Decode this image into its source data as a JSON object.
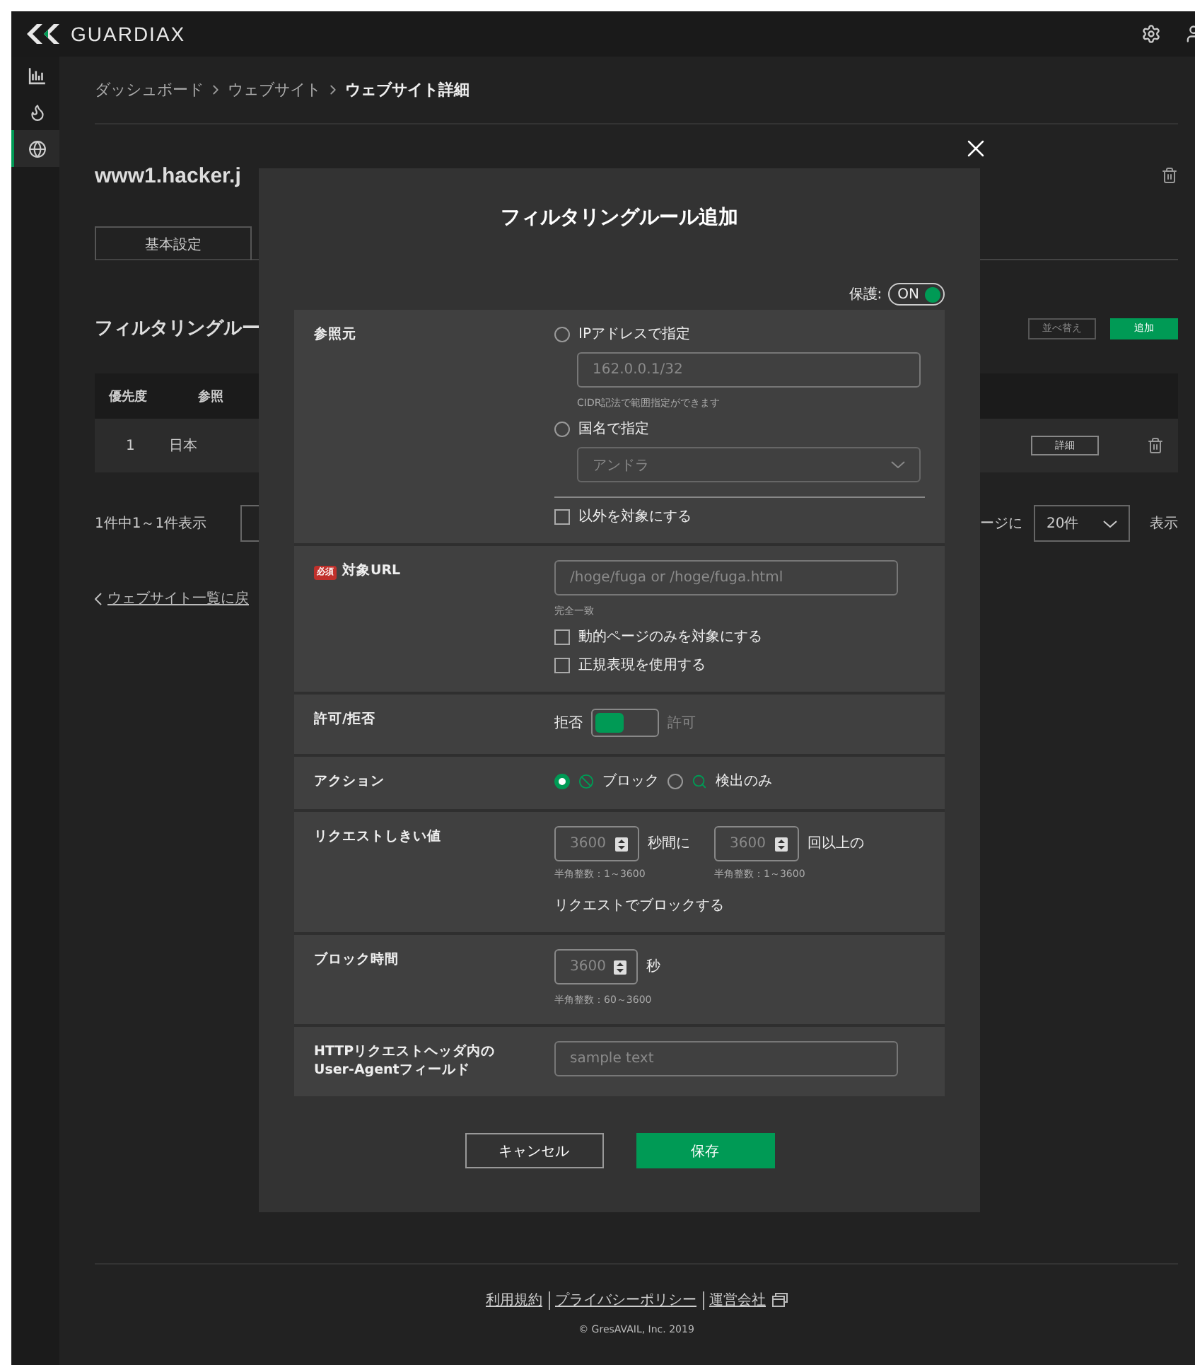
{
  "header": {
    "logo": "GUARDIAX"
  },
  "sidebar": {
    "items": [
      {
        "kind": "chart",
        "selected": false
      },
      {
        "kind": "flame",
        "selected": false
      },
      {
        "kind": "globe",
        "selected": true
      }
    ]
  },
  "breadcrumb": [
    {
      "label": "ダッシュボード",
      "current": false
    },
    {
      "label": "ウェブサイト",
      "current": false
    },
    {
      "label": "ウェブサイト詳細",
      "current": true
    }
  ],
  "site": {
    "title": "www1.hacker.j"
  },
  "tabs": [
    {
      "label": "基本設定",
      "selected": false
    }
  ],
  "section": {
    "title": "フィルタリングルー",
    "buttons": [
      {
        "label": "並べ替え",
        "kind": "outline"
      },
      {
        "label": "追加",
        "kind": "primary"
      }
    ]
  },
  "table": {
    "columns": [
      "優先度",
      "参照"
    ],
    "rows": [
      {
        "cells": [
          "1",
          "日本"
        ],
        "action": "詳細"
      }
    ]
  },
  "pagination": {
    "summary": "1件中1～1件表示",
    "per_page_prefix": "ージに",
    "per_page": "20件",
    "suffix": "表示"
  },
  "back_link": "ウェブサイト一覧に戻",
  "footer": {
    "links": [
      "利用規約",
      "プライバシーポリシー",
      "運営会社"
    ],
    "copyright": "© GresAVAIL, Inc. 2019"
  },
  "modal": {
    "title": "フィルタリングルール追加",
    "protection": {
      "label": "保護:",
      "value": "ON",
      "on": true
    },
    "rows": [
      {
        "kind": "source",
        "label": "参照元",
        "options": [
          {
            "label": "IPアドレスで指定",
            "selected": false
          },
          {
            "label": "国名で指定",
            "selected": false
          }
        ],
        "ip_placeholder": "162.0.0.1/32",
        "ip_hint": "CIDR記法で範囲指定ができます",
        "country": {
          "value": "アンドラ",
          "disabled": true
        },
        "exclude": {
          "label": "以外を対象にする",
          "checked": false
        }
      },
      {
        "kind": "url",
        "label": "対象URL",
        "required_badge": "必須",
        "placeholder": "/hoge/fuga or /hoge/fuga.html",
        "hint": "完全一致",
        "checks": [
          {
            "label": "動的ページのみを対象にする",
            "checked": false
          },
          {
            "label": "正規表現を使用する",
            "checked": false
          }
        ]
      },
      {
        "kind": "toggle",
        "label": "許可/拒否",
        "off_label": "拒否",
        "on_label": "許可",
        "allow": false
      },
      {
        "kind": "action",
        "label": "アクション",
        "options": [
          {
            "label": "ブロック",
            "selected": true
          },
          {
            "label": "検出のみ",
            "selected": false
          }
        ]
      },
      {
        "kind": "threshold",
        "label": "リクエストしきい値",
        "seconds_placeholder": "3600",
        "seconds_unit": "秒間に",
        "count_placeholder": "3600",
        "count_unit": "回以上の",
        "hints": [
          "半角整数：1～3600",
          "半角整数：1～3600"
        ],
        "note": "リクエストでブロックする"
      },
      {
        "kind": "duration",
        "label": "ブロック時間",
        "placeholder": "3600",
        "unit": "秒",
        "hint": "半角整数：60～3600"
      },
      {
        "kind": "text",
        "label": "HTTPリクエストヘッダ内の\nUser-Agentフィールド",
        "placeholder": "sample text"
      }
    ],
    "buttons": [
      {
        "label": "キャンセル",
        "kind": "secondary"
      },
      {
        "label": "保存",
        "kind": "primary"
      }
    ]
  }
}
